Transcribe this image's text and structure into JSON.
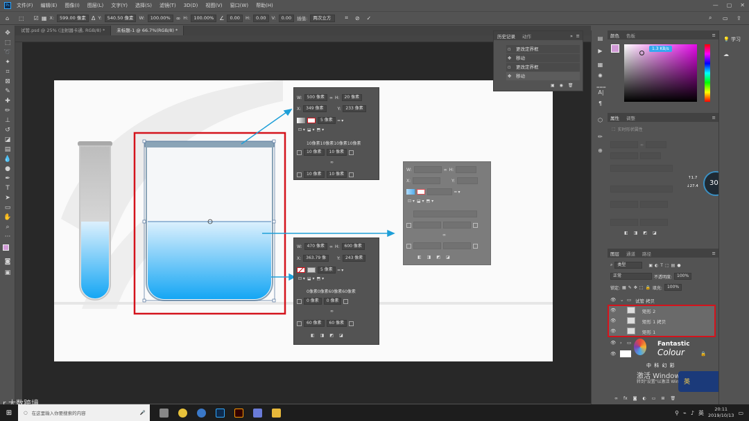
{
  "app": {
    "logo": "Ps"
  },
  "menu": [
    "文件(F)",
    "编辑(E)",
    "图像(I)",
    "图层(L)",
    "文字(Y)",
    "选择(S)",
    "滤镜(T)",
    "3D(D)",
    "视图(V)",
    "窗口(W)",
    "帮助(H)"
  ],
  "options": {
    "x_label": "X:",
    "x_value": "599.00 像素",
    "y_label": "Y:",
    "y_value": "540.50 像素",
    "w_label": "W:",
    "w_value": "100.00%",
    "h_label": "H:",
    "h_value": "100.00%",
    "angle_value": "0.00",
    "hskew_label": "H:",
    "hskew_value": "0.00",
    "vskew_label": "V:",
    "vskew_value": "0.00",
    "interp_label": "插值:",
    "interp_value": "两次立方"
  },
  "tabs": [
    "试管.psd @ 25% (注射器卡通, RGB/8) *",
    "未标题-1 @ 66.7%(RGB/8) *"
  ],
  "prop1": {
    "w": "500 像素",
    "h": "20 像素",
    "x": "349 像素",
    "y": "233 像素",
    "stroke": "5 像素",
    "corners": "10像素10像素10像素10像素",
    "c1": "10 像素",
    "c2": "10 像素",
    "c3": "10 像素",
    "c4": "10 像素"
  },
  "prop2": {
    "w": "470 像素",
    "h": "600 像素",
    "x": "363.79 像",
    "y": "243 像素",
    "stroke": "5 像素",
    "corners": "0像素0像素60像素60像素",
    "c1": "0 像素",
    "c2": "0 像素",
    "c3": "60 像素",
    "c4": "60 像素"
  },
  "history": {
    "tabs": [
      "历史记录",
      "动作"
    ],
    "items": [
      "更改定界框",
      "移动",
      "更改定界框",
      "移动"
    ]
  },
  "color": {
    "tabs": [
      "颜色",
      "色板"
    ],
    "readout": "1.3 KB/s"
  },
  "properties": {
    "tabs": [
      "属性",
      "调整"
    ],
    "item": "实时形状属性"
  },
  "dial": {
    "value": "30",
    "unit": "%",
    "up": "1.7",
    "down": "27.4"
  },
  "layers": {
    "tabs": [
      "图层",
      "通道",
      "路径"
    ],
    "kind": "类型",
    "mode": "正常",
    "opacity_label": "不透明度:",
    "opacity_value": "100%",
    "lock_label": "锁定:",
    "fill_label": "填充:",
    "fill_value": "100%",
    "group": "试管 拷贝",
    "rows": [
      "矩形 2",
      "矩形 1 拷贝",
      "矩形 1"
    ]
  },
  "watermark": {
    "brand1": "Fantastic",
    "brand2": "Colour",
    "cn": "中 科 幻 彩",
    "activate": "激活 Windows",
    "activate_sub": "转到\"设置\"以激活 Windows。",
    "bottom_left": "大数跨境"
  },
  "learn": {
    "label": "学习"
  },
  "taskbar": {
    "search": "在这里输入你要搜索的内容",
    "time": "20:11",
    "date": "2019/10/13",
    "ime": "英"
  },
  "colors": {
    "accent": "#31a8ff",
    "highlight_red": "#d4131c",
    "liquid_top": "#cfeafc",
    "liquid_bottom": "#18a8f5",
    "arrow": "#1e9fd8"
  }
}
